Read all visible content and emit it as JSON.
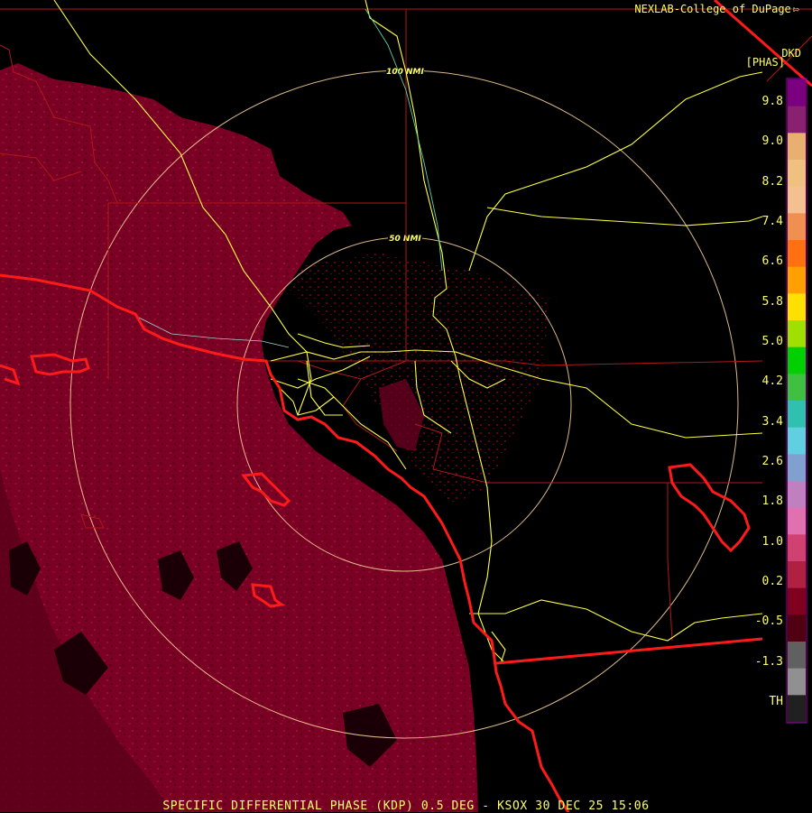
{
  "header": {
    "credit": "NEXLAB-College of DuPage",
    "credit_icon": "corner-arrow-icon",
    "product_code": "DKD",
    "units": "[PHAS]"
  },
  "range_rings": [
    "50 NMI",
    "100 NMI"
  ],
  "colorbar": {
    "labels": [
      "9.8",
      "9.0",
      "8.2",
      "7.4",
      "6.6",
      "5.8",
      "5.0",
      "4.2",
      "3.4",
      "2.6",
      "1.8",
      "1.0",
      "0.2",
      "-0.5",
      "-1.3",
      "TH"
    ],
    "colors": [
      "#7a0080",
      "#8a2070",
      "#e8b070",
      "#f0c080",
      "#f5c090",
      "#f09050",
      "#ff7010",
      "#ffa000",
      "#ffe000",
      "#a0e000",
      "#00d000",
      "#40c040",
      "#30c0b0",
      "#60d0e0",
      "#80a0d0",
      "#c080c0",
      "#e070b0",
      "#d04070",
      "#b02040",
      "#800020",
      "#500010",
      "#606060",
      "#909090",
      "#202020"
    ]
  },
  "footer": "SPECIFIC DIFFERENTIAL PHASE (KDP) 0.5 DEG - KSOX 30 DEC 25 15:06"
}
